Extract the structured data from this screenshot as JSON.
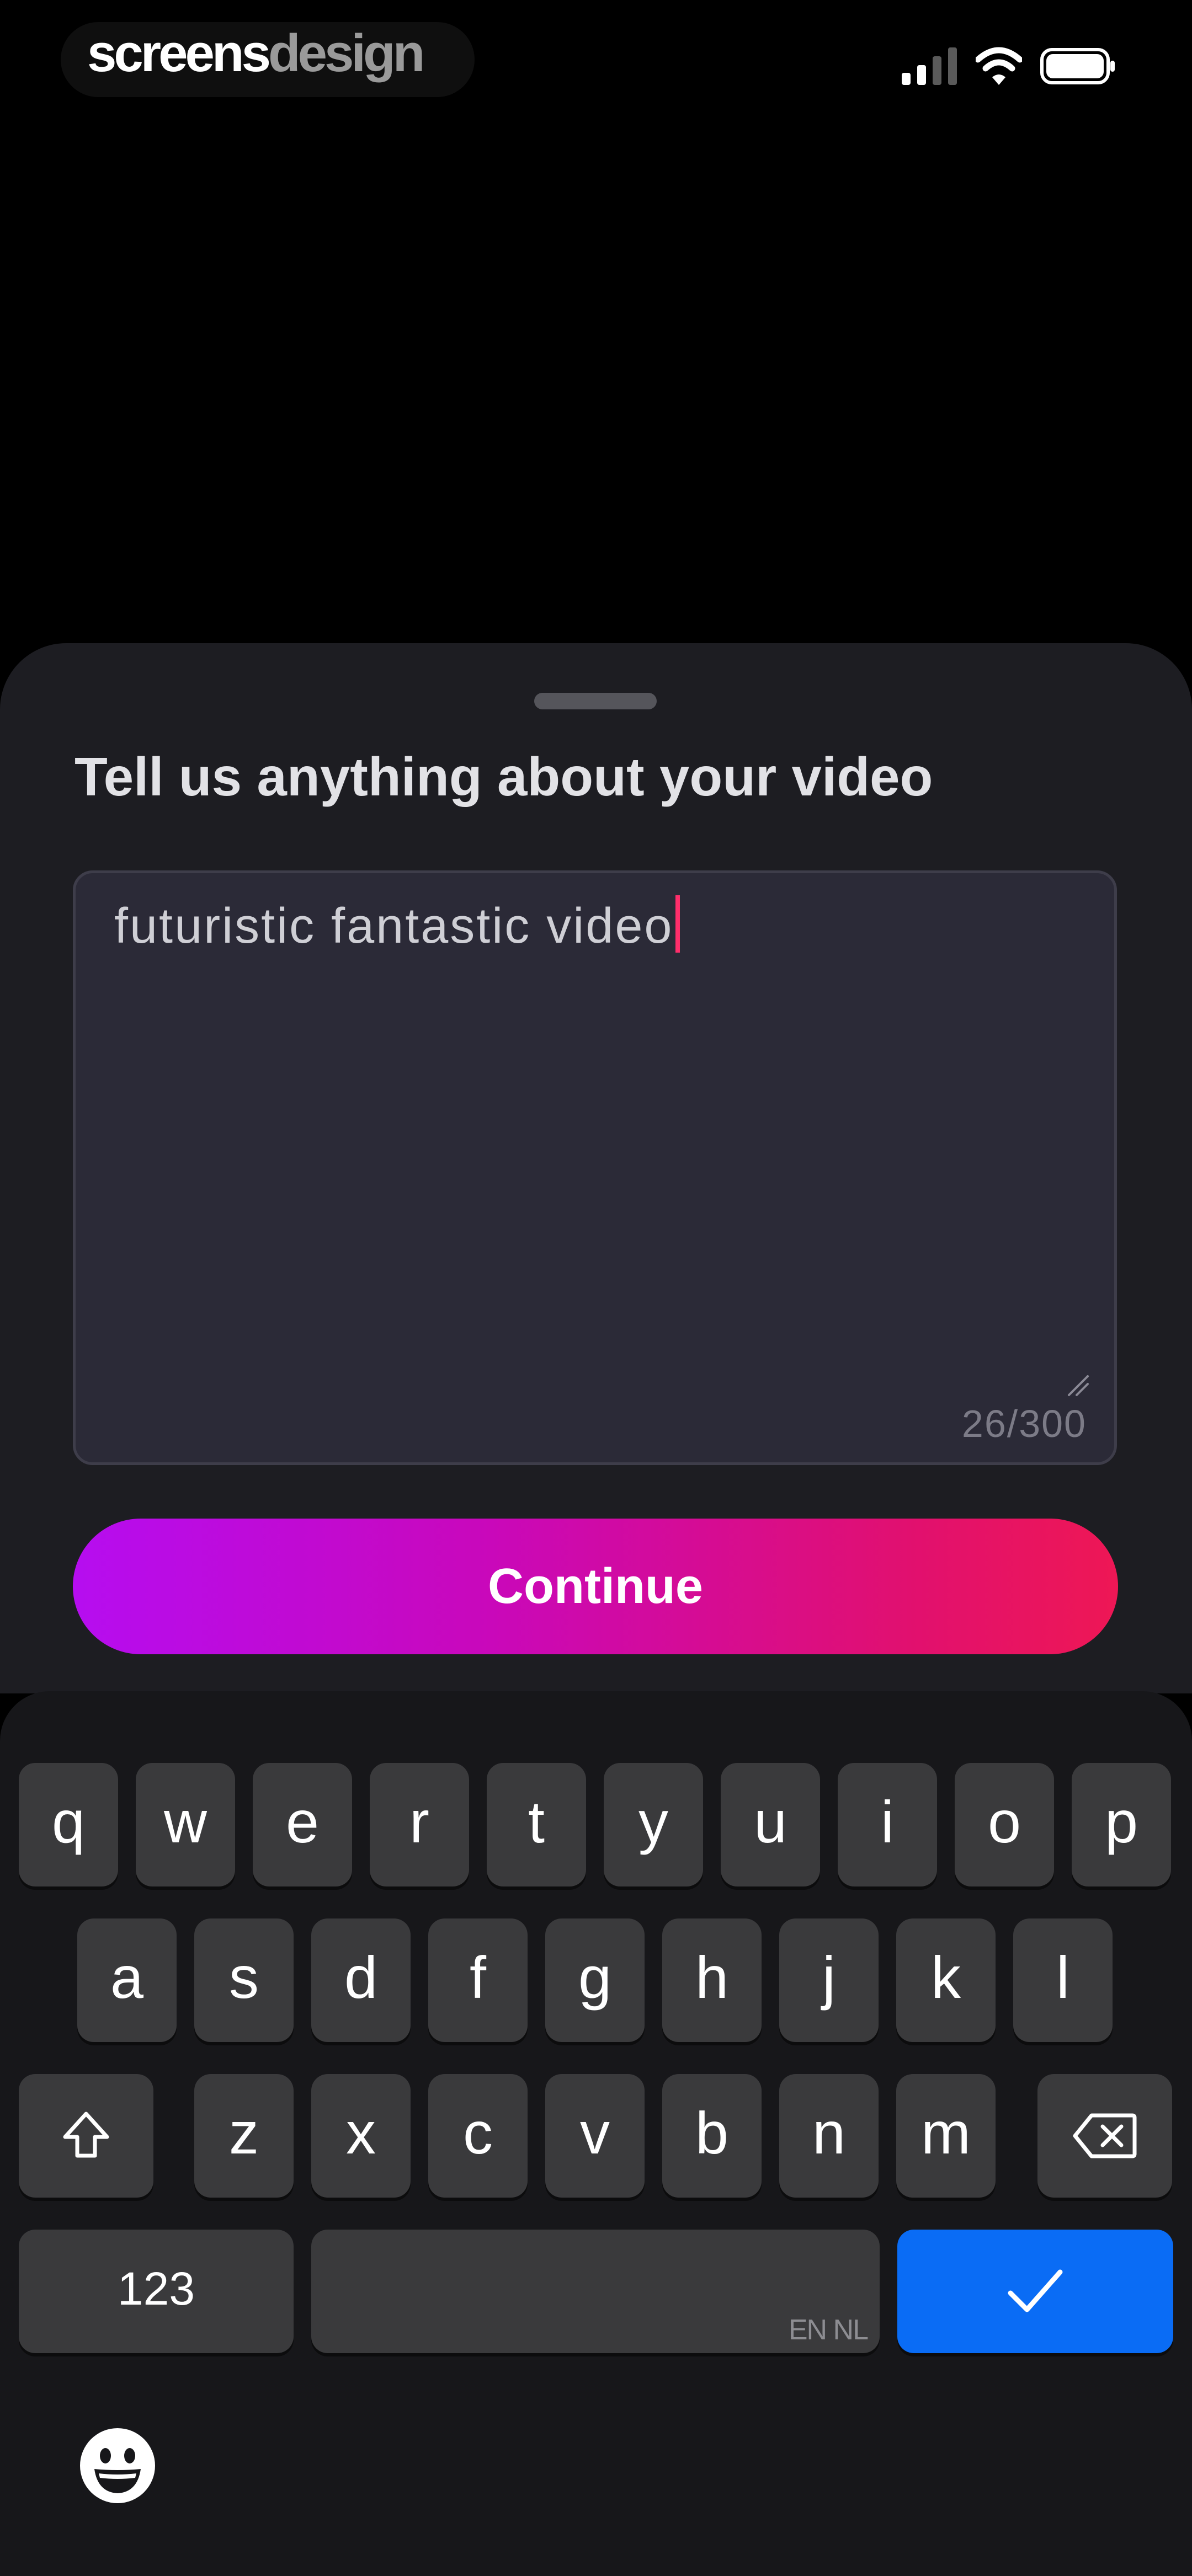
{
  "status_bar": {
    "brand_primary": "screens",
    "brand_secondary": "design",
    "icons": [
      "cellular-signal-icon",
      "wifi-icon",
      "battery-icon"
    ]
  },
  "sheet": {
    "title": "Tell us anything about your video",
    "textarea": {
      "value": "futuristic fantastic video",
      "char_count": "26/300",
      "caret_color": "#ff2e6b"
    },
    "continue_label": "Continue",
    "continue_gradient": [
      "#b60df0",
      "#ee1755"
    ]
  },
  "keyboard": {
    "row1": [
      "q",
      "w",
      "e",
      "r",
      "t",
      "y",
      "u",
      "i",
      "o",
      "p"
    ],
    "row2": [
      "a",
      "s",
      "d",
      "f",
      "g",
      "h",
      "j",
      "k",
      "l"
    ],
    "row3": [
      "z",
      "x",
      "c",
      "v",
      "b",
      "n",
      "m"
    ],
    "numbers_label": "123",
    "space_hint": "EN NL",
    "done_color": "#0a6cf5",
    "icons": [
      "shift-icon",
      "backspace-icon",
      "checkmark-icon",
      "emoji-icon"
    ]
  }
}
